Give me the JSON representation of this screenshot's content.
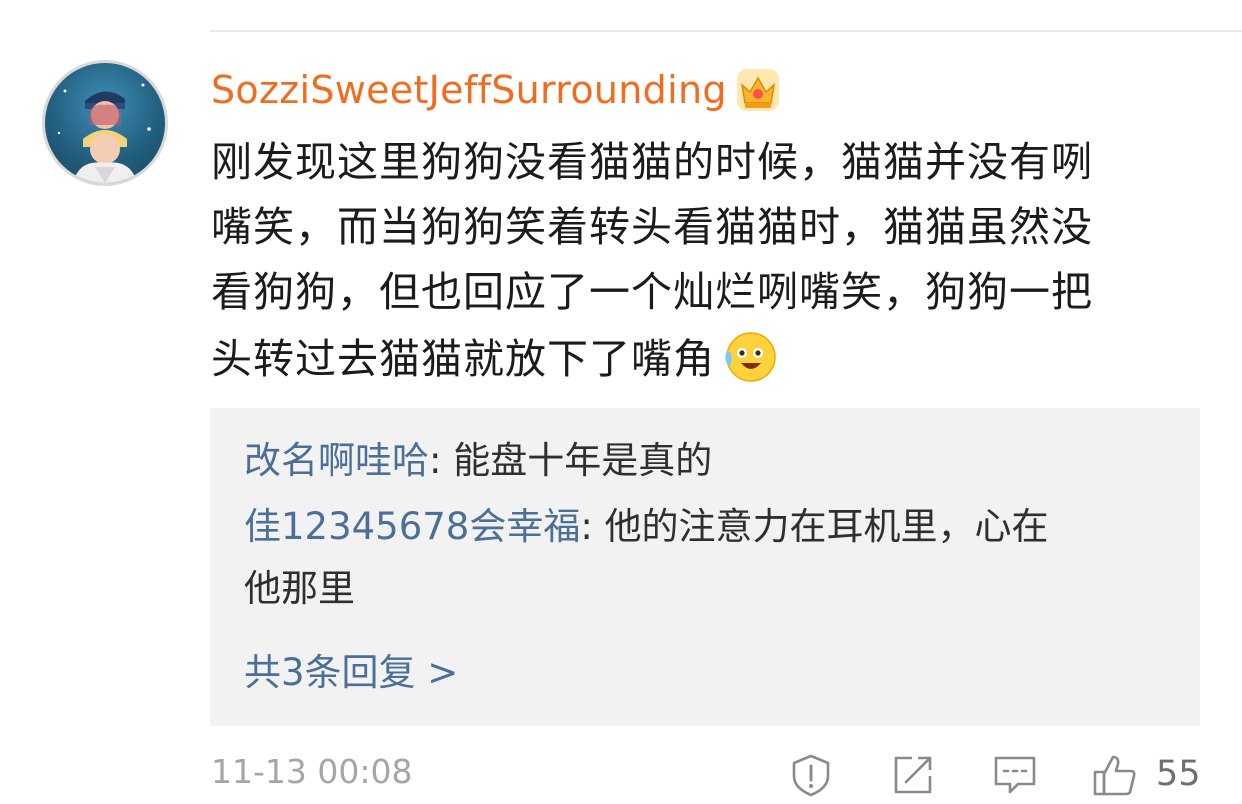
{
  "comment": {
    "username": "SozziSweetJeffSurrounding",
    "text_lines": [
      "刚发现这里狗狗没看猫猫的时候，猫猫并没有咧",
      "嘴笑，而当狗狗笑着转头看猫猫时，猫猫虽然没",
      "看狗狗，但也回应了一个灿烂咧嘴笑，狗狗一把",
      "头转过去猫猫就放下了嘴角"
    ],
    "timestamp": "11-13 00:08",
    "like_count": "55"
  },
  "replies": [
    {
      "name": "改名啊哇哈",
      "sep": ": ",
      "text_lines": [
        "能盘十年是真的"
      ]
    },
    {
      "name": "佳12345678会幸福",
      "sep": ": ",
      "text_lines": [
        "他的注意力在耳机里，心在",
        "他那里"
      ]
    }
  ],
  "more_replies_label": "共3条回复 >",
  "icons": {
    "badge": "crown-badge-icon",
    "emoji": "grin-emoji-icon",
    "report": "report-shield-icon",
    "share": "share-icon",
    "comment": "comment-icon",
    "like": "thumbs-up-icon"
  },
  "colors": {
    "username": "#f26c1f",
    "reply_name": "#4b6f98",
    "reply_bg": "#f2f2f2",
    "meta": "#a6a6a6"
  }
}
